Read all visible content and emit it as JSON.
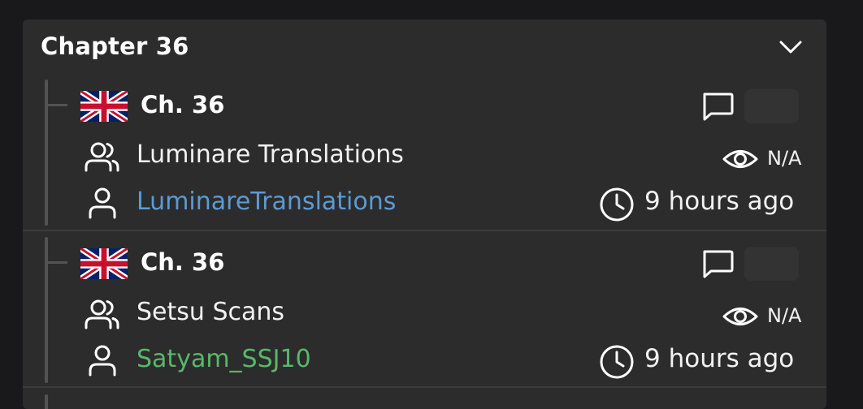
{
  "chapter": {
    "title": "Chapter 36"
  },
  "entries": [
    {
      "chapter_label": "Ch. 36",
      "flag_icon": "uk-flag-icon",
      "group": "Luminare Translations",
      "views": "N/A",
      "uploader": "LuminareTranslations",
      "uploader_color": "#5b9bd5",
      "time": "9 hours ago"
    },
    {
      "chapter_label": "Ch. 36",
      "flag_icon": "uk-flag-icon",
      "group": "Setsu Scans",
      "views": "N/A",
      "uploader": "Satyam_SSJ10",
      "uploader_color": "#58b86a",
      "time": "9 hours ago"
    }
  ],
  "colors": {
    "background": "#19191b",
    "card": "#2c2c2c",
    "tree_line": "#535353"
  }
}
